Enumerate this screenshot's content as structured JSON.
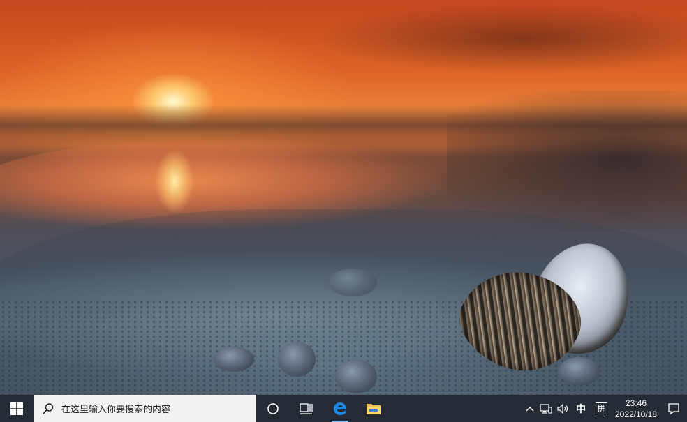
{
  "taskbar": {
    "search_placeholder": "在这里输入你要搜索的内容",
    "pinned": [
      {
        "name": "cortana-icon"
      },
      {
        "name": "task-view-icon"
      },
      {
        "name": "edge-icon"
      },
      {
        "name": "file-explorer-icon"
      }
    ],
    "tray": {
      "ime_mode": "中",
      "ime_icon": "拼",
      "time": "23:46",
      "date": "2022/10/18"
    },
    "colors": {
      "taskbar_bg": "#262c36",
      "search_bg": "#f3f3f3",
      "active_indicator": "#79b5ea",
      "windows_logo": "#ffffff",
      "edge_blue": "#1e88e5",
      "explorer_yellow": "#f2c14e"
    }
  }
}
